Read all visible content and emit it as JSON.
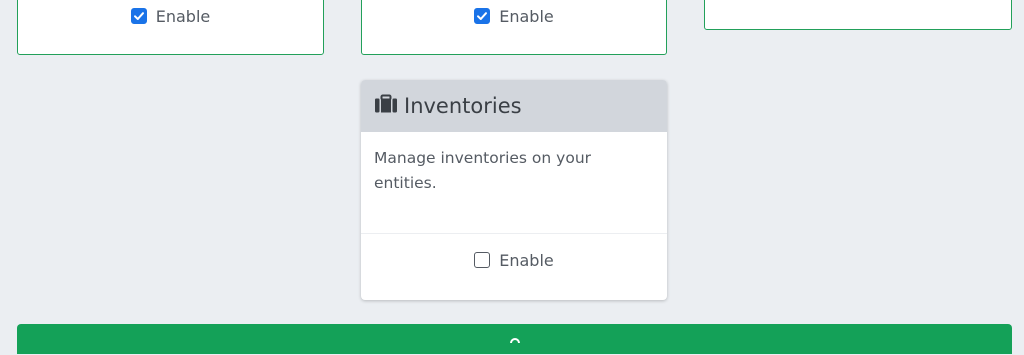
{
  "cards": [
    {
      "id": "left",
      "enable_label": "Enable",
      "enabled": true
    },
    {
      "id": "middle",
      "enable_label": "Enable",
      "enabled": true
    }
  ],
  "inventories": {
    "icon": "briefcase-icon",
    "title": "Inventories",
    "description": "Manage inventories on your entities.",
    "enable_label": "Enable",
    "enabled": false
  },
  "colors": {
    "enabled_border": "#22a05a",
    "checkbox_checked": "#1a73e8",
    "save_bar": "#14a158",
    "header_bg": "#d2d6dc",
    "page_bg": "#ebeef2"
  }
}
